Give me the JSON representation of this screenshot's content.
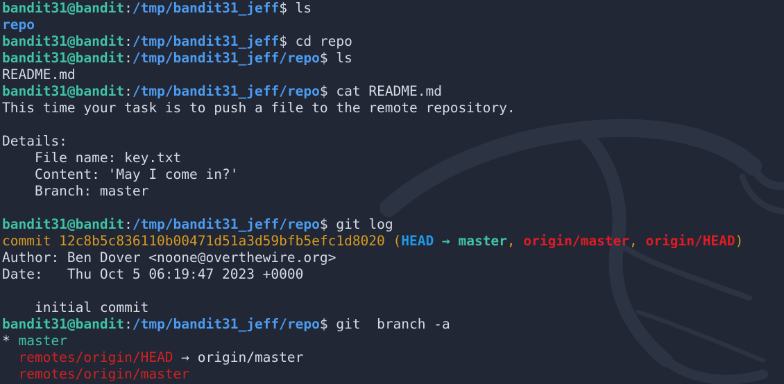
{
  "prompt": {
    "user_host": "bandit31@bandit",
    "colon": ":",
    "dollar": "$"
  },
  "lines": [
    {
      "path": "/tmp/bandit31_jeff",
      "cmd": " ls"
    },
    {
      "out_dir": "repo"
    },
    {
      "path": "/tmp/bandit31_jeff",
      "cmd": " cd repo"
    },
    {
      "path": "/tmp/bandit31_jeff/repo",
      "cmd": " ls"
    },
    {
      "out": "README.md"
    },
    {
      "path": "/tmp/bandit31_jeff/repo",
      "cmd": " cat README.md"
    },
    {
      "out": "This time your task is to push a file to the remote repository."
    },
    {
      "out": ""
    },
    {
      "out": "Details:"
    },
    {
      "out": "    File name: key.txt"
    },
    {
      "out": "    Content: 'May I come in?'"
    },
    {
      "out": "    Branch: master"
    },
    {
      "out": ""
    },
    {
      "path": "/tmp/bandit31_jeff/repo",
      "cmd": " git log"
    },
    {
      "commit_prefix": "commit 12c8b5c836110b00471d51a3d59bfb5efc1d8020 (",
      "head": "HEAD",
      "arrow": " → ",
      "local_branch": "master",
      "sep1": ", ",
      "remote1": "origin/master",
      "sep2": ", ",
      "remote2": "origin/HEAD",
      "close": ")"
    },
    {
      "out": "Author: Ben Dover <noone@overthewire.org>"
    },
    {
      "out": "Date:   Thu Oct 5 06:19:47 2023 +0000"
    },
    {
      "out": ""
    },
    {
      "out": "    initial commit"
    },
    {
      "path": "/tmp/bandit31_jeff/repo",
      "cmd": " git  branch -a"
    },
    {
      "star": "* ",
      "current": "master"
    },
    {
      "indent": "  ",
      "remote_ref": "remotes/origin/HEAD",
      "ref_arrow": " → origin/master"
    },
    {
      "indent": "  ",
      "remote_ref": "remotes/origin/master"
    }
  ],
  "colors": {
    "background": "#212734",
    "text": "#d6dce6",
    "prompt_user": "#3fc3a4",
    "prompt_path": "#4d9cf2",
    "commit": "#d69a22",
    "head": "#1e9ae8",
    "remote": "#e01b24"
  },
  "background_art": "kali-dragon-watermark"
}
